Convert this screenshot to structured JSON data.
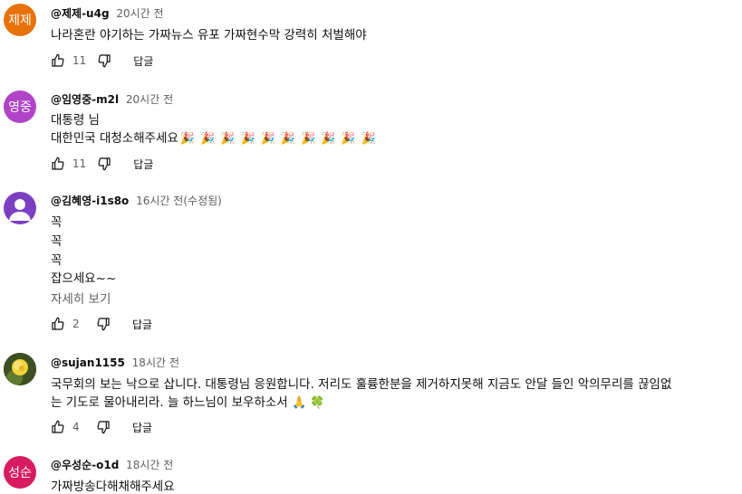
{
  "comments": [
    {
      "author": "@제제-u4g",
      "time": "20시간 전",
      "avatar_text": "제제",
      "avatar_color": "#e8710a",
      "lines": [
        "나라혼란 야기하는 가짜뉴스 유포 가짜현수막 강력히 처벌해야"
      ],
      "likes": "11",
      "reply_label": "답글"
    },
    {
      "author": "@임영중-m2l",
      "time": "20시간 전",
      "avatar_text": "영중",
      "avatar_color": "#b043c7",
      "lines": [
        "대통령 님",
        "대한민국 대청소해주세요"
      ],
      "emoji": "🎉",
      "emoji_count": 10,
      "likes": "11",
      "reply_label": "답글"
    },
    {
      "author": "@김혜영-i1s8o",
      "time": "16시간 전(수정됨)",
      "avatar_text": "",
      "avatar_color": "#7b3fc4",
      "lines": [
        "꼭",
        "꼭",
        "꼭",
        "잡으세요~~"
      ],
      "more_label": "자세히 보기",
      "likes": "2",
      "reply_label": "답글"
    },
    {
      "author": "@sujan1155",
      "time": "18시간 전",
      "avatar_text": "",
      "avatar_color": "#4a5a2a",
      "lines": [
        "국무회의 보는 낙으로 삽니다. 대통령님 응원합니다. 저리도 훌륭한분을 제거하지못해 지금도 안달 들인 악의무리를 끊임없",
        "는 기도로 물아내리라. 늘 하느님이 보우하소서"
      ],
      "emoji_tail": "🙏 🍀",
      "likes": "4",
      "reply_label": "답글"
    },
    {
      "author": "@우성순-o1d",
      "time": "18시간 전",
      "avatar_text": "성순",
      "avatar_color": "#d81b60",
      "lines": [
        "가짜방송다해채해주세요"
      ]
    }
  ]
}
